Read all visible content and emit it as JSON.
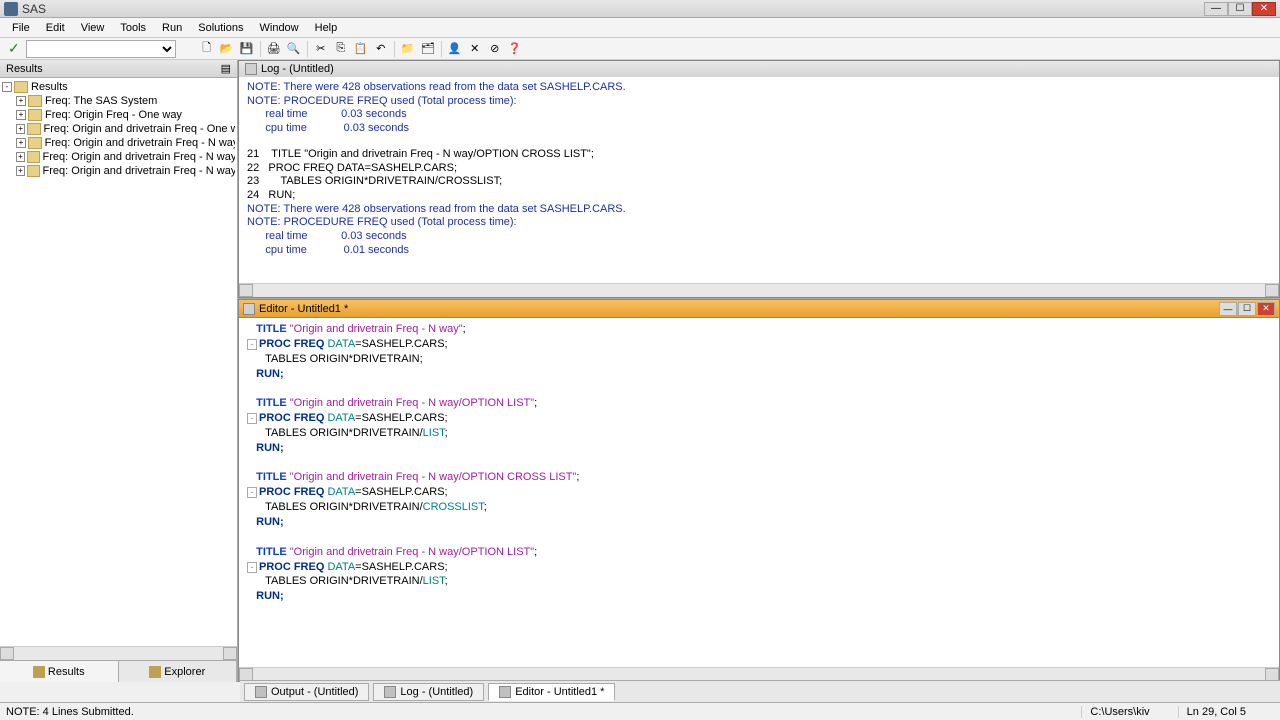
{
  "window": {
    "title": "SAS"
  },
  "menu": [
    "File",
    "Edit",
    "View",
    "Tools",
    "Run",
    "Solutions",
    "Window",
    "Help"
  ],
  "sidebar": {
    "title": "Results",
    "root": "Results",
    "items": [
      "Freq:  The SAS System",
      "Freq:  Origin Freq - One way",
      "Freq:  Origin and drivetrain Freq - One way",
      "Freq:  Origin and drivetrain Freq - N way",
      "Freq:  Origin and drivetrain Freq - N way/OPT",
      "Freq:  Origin and drivetrain Freq - N way/OPT"
    ],
    "tabs": {
      "results": "Results",
      "explorer": "Explorer"
    }
  },
  "log": {
    "title": "Log - (Untitled)",
    "note": "NOTE: ",
    "line1": "There were 428 observations read from the data set SASHELP.CARS.",
    "line2": "PROCEDURE FREQ used (Total process time):",
    "r1": "      real time           0.03 seconds",
    "c1": "      cpu time            0.03 seconds",
    "n21": "21",
    "t21": "    TITLE \"Origin and drivetrain Freq - N way/OPTION CROSS LIST\";",
    "n22": "22",
    "t22": "   PROC FREQ DATA=SASHELP.CARS;",
    "n23": "23",
    "t23": "       TABLES ORIGIN*DRIVETRAIN/CROSSLIST;",
    "n24": "24",
    "t24": "   RUN;",
    "r2": "      real time           0.03 seconds",
    "c2": "      cpu time            0.01 seconds"
  },
  "editor": {
    "title": "Editor - Untitled1 *",
    "blocks": [
      {
        "title_pre": "   TITLE ",
        "title_str": "\"Origin and drivetrain Freq - N way\"",
        "title_post": ";",
        "proc": "PROC FREQ ",
        "data_kw": "DATA",
        "data_rest": "=SASHELP.CARS;",
        "tables_pre": "      TABLES ORIGIN*DRIVETRAIN;",
        "opt": "",
        "run": "RUN;"
      },
      {
        "title_pre": "   TITLE ",
        "title_str": "\"Origin and drivetrain Freq - N way/OPTION LIST\"",
        "title_post": ";",
        "proc": "PROC FREQ ",
        "data_kw": "DATA",
        "data_rest": "=SASHELP.CARS;",
        "tables_pre": "      TABLES ORIGIN*DRIVETRAIN/",
        "opt": "LIST",
        "tables_post": ";",
        "run": "RUN;"
      },
      {
        "title_pre": "   TITLE ",
        "title_str": "\"Origin and drivetrain Freq - N way/OPTION CROSS LIST\"",
        "title_post": ";",
        "proc": "PROC FREQ ",
        "data_kw": "DATA",
        "data_rest": "=SASHELP.CARS;",
        "tables_pre": "      TABLES ORIGIN*DRIVETRAIN/",
        "opt": "CROSSLIST",
        "tables_post": ";",
        "run": "RUN;"
      },
      {
        "title_pre": "   TITLE ",
        "title_str": "\"Origin and drivetrain Freq - N way/OPTION LIST\"",
        "title_post": ";",
        "proc": "PROC FREQ ",
        "data_kw": "DATA",
        "data_rest": "=SASHELP.CARS;",
        "tables_pre": "      TABLES ORIGIN*DRIVETRAIN/",
        "opt": "LIST",
        "tables_post": ";",
        "run": "RUN;"
      }
    ]
  },
  "bottom_tabs": {
    "output": "Output - (Untitled)",
    "log": "Log - (Untitled)",
    "editor": "Editor - Untitled1 *"
  },
  "status": {
    "left": "NOTE: 4 Lines Submitted.",
    "path": "C:\\Users\\kiv",
    "pos": "Ln 29, Col 5"
  }
}
